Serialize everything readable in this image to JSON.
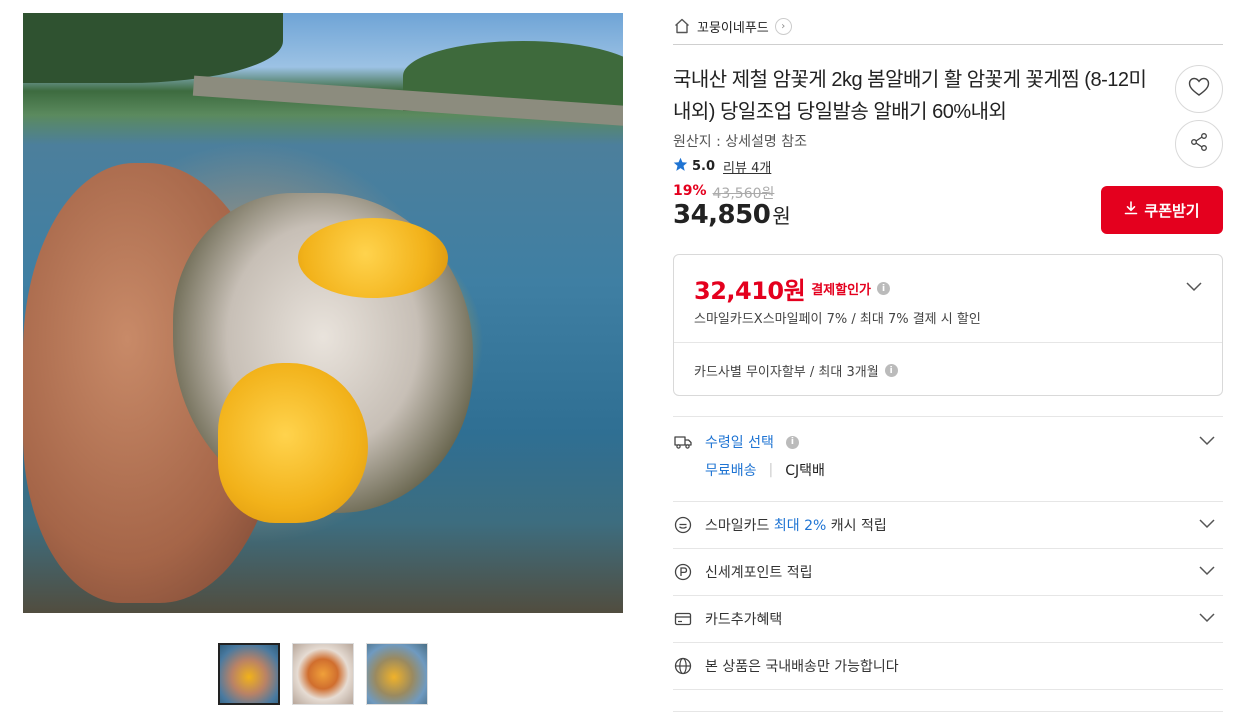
{
  "gallery": {
    "main_image_alt": "",
    "thumbnails": [
      {
        "name": "thumbnail-1",
        "active": true
      },
      {
        "name": "thumbnail-2",
        "active": false
      },
      {
        "name": "thumbnail-3",
        "active": false
      }
    ]
  },
  "seller": {
    "name": "꼬뭉이네푸드",
    "arrow": "›"
  },
  "product": {
    "title": "국내산 제철 암꽃게 2kg 봄알배기 활 암꽃게 꽃게찜 (8-12미내외) 당일조업 당일발송 알배기 60%내외",
    "origin": "원산지 : 상세설명 참조",
    "rating": "5.0",
    "reviews": "리뷰 4개",
    "discount_rate": "19%",
    "original_price": "43,560원",
    "price": "34,850",
    "currency": "원"
  },
  "coupon": {
    "label": "쿠폰받기"
  },
  "payment": {
    "discounted_price": "32,410원",
    "label": "결제할인가",
    "desc": "스마일카드X스마일페이 7% / 최대 7% 결제 시 할인",
    "installment": "카드사별 무이자할부 / 최대 3개월"
  },
  "delivery": {
    "label": "수령일 선택",
    "free": "무료배송",
    "separator": "|",
    "courier": "CJ택배"
  },
  "benefits": {
    "smile_prefix": "스마일카드",
    "smile_highlight": "최대 2%",
    "smile_suffix": "캐시 적립",
    "shinsegae": "신세계포인트 적립",
    "card_extra": "카드추가혜택",
    "domestic": "본 상품은 국내배송만 가능합니다"
  },
  "colors": {
    "accent_red": "#e4001e",
    "link_blue": "#1f74d3"
  },
  "icons": {
    "home": "home-icon",
    "heart": "heart-icon",
    "share": "share-icon",
    "star": "star-icon",
    "download": "download-icon",
    "truck": "truck-icon",
    "smile": "smile-card-icon",
    "point": "point-icon",
    "card": "card-icon",
    "globe": "globe-icon",
    "chevron": "chevron-down-icon"
  }
}
